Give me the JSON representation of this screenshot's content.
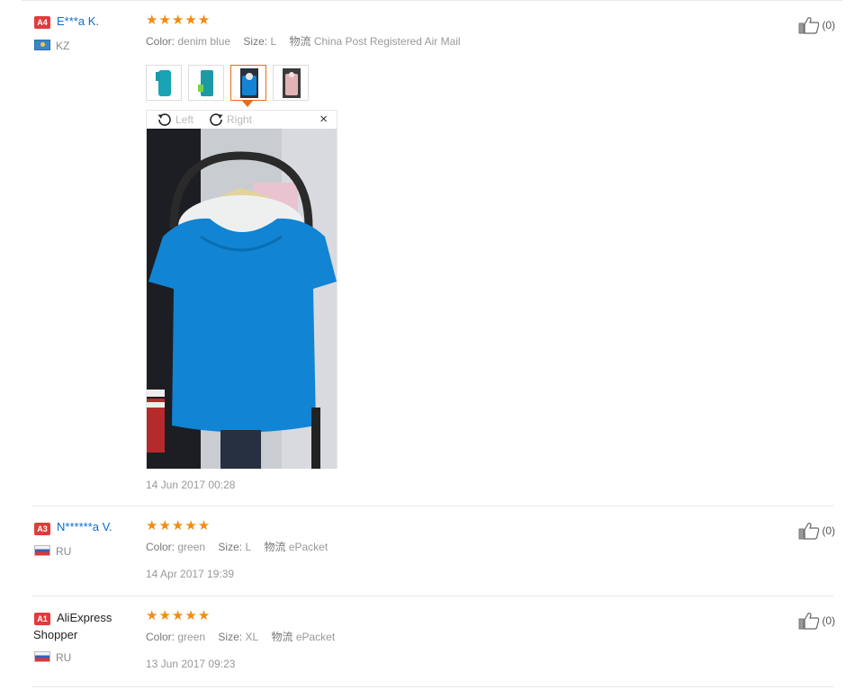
{
  "reviews": [
    {
      "level": "A4",
      "name": "E***a K.",
      "country": "KZ",
      "attrs": {
        "color_label": "Color:",
        "color": "denim blue",
        "size_label": "Size:",
        "size": "L",
        "ship_label": "物流",
        "ship": "China Post Registered Air Mail"
      },
      "date": "14 Jun 2017 00:28",
      "helpful": "(0)",
      "viewer": {
        "left_label": "Left",
        "right_label": "Right",
        "close": "×"
      }
    },
    {
      "level": "A3",
      "name": "N******a V.",
      "country": "RU",
      "attrs": {
        "color_label": "Color:",
        "color": "green",
        "size_label": "Size:",
        "size": "L",
        "ship_label": "物流",
        "ship": "ePacket"
      },
      "date": "14 Apr 2017 19:39",
      "helpful": "(0)"
    },
    {
      "level": "A1",
      "name_line1": "AliExpress",
      "name_line2": "Shopper",
      "country": "RU",
      "attrs": {
        "color_label": "Color:",
        "color": "green",
        "size_label": "Size:",
        "size": "XL",
        "ship_label": "物流",
        "ship": "ePacket"
      },
      "date": "13 Jun 2017 09:23",
      "helpful": "(0)"
    }
  ],
  "stars": "★★★★★",
  "colors": {
    "star": "#f28b11",
    "badge": "#e4393c",
    "link": "#0a6dcc",
    "selected": "#e96a1f"
  }
}
